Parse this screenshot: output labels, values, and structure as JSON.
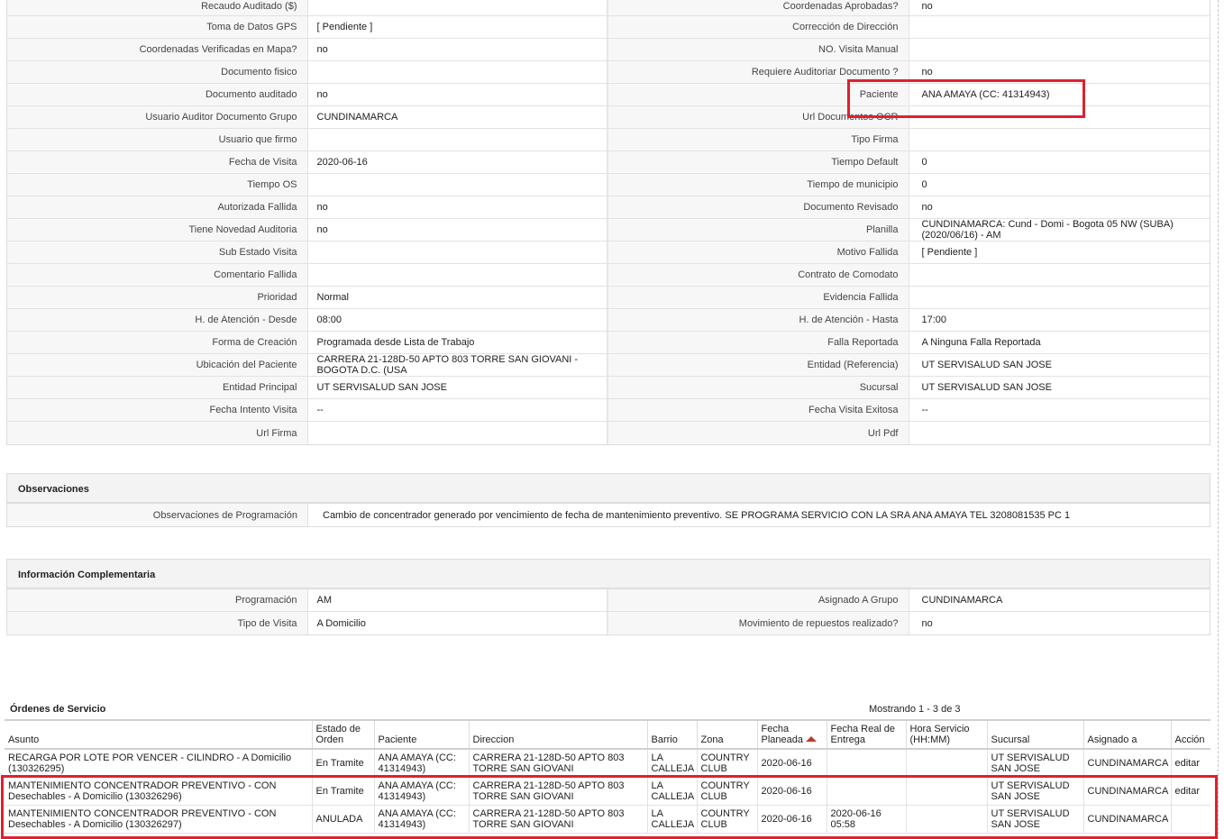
{
  "details": [
    {
      "l1": "Recaudo Auditado ($)",
      "v1": "",
      "l2": "Coordenadas Aprobadas?",
      "v2": "no"
    },
    {
      "l1": "Toma de Datos GPS",
      "v1": "[ Pendiente ]",
      "l2": "Corrección de Dirección",
      "v2": ""
    },
    {
      "l1": "Coordenadas Verificadas en Mapa?",
      "v1": "no",
      "l2": "NO. Visita Manual",
      "v2": ""
    },
    {
      "l1": "Documento fisico",
      "v1": "",
      "l2": "Requiere Auditoriar Documento ?",
      "v2": "no"
    },
    {
      "l1": "Documento auditado",
      "v1": "no",
      "l2": "Paciente",
      "v2": "ANA AMAYA (CC: 41314943)"
    },
    {
      "l1": "Usuario Auditor Documento Grupo",
      "v1": "CUNDINAMARCA",
      "l2": "Url Documentos OCR",
      "v2": ""
    },
    {
      "l1": "Usuario que firmo",
      "v1": "",
      "l2": "Tipo Firma",
      "v2": ""
    },
    {
      "l1": "Fecha de Visita",
      "v1": "2020-06-16",
      "l2": "Tiempo Default",
      "v2": "0"
    },
    {
      "l1": "Tiempo OS",
      "v1": "",
      "l2": "Tiempo de municipio",
      "v2": "0"
    },
    {
      "l1": "Autorizada Fallida",
      "v1": "no",
      "l2": "Documento Revisado",
      "v2": "no"
    },
    {
      "l1": "Tiene Novedad Auditoria",
      "v1": "no",
      "l2": "Planilla",
      "v2": "CUNDINAMARCA: Cund - Domi - Bogota 05 NW (SUBA) (2020/06/16) - AM"
    },
    {
      "l1": "Sub Estado Visita",
      "v1": "",
      "l2": "Motivo Fallida",
      "v2": "[ Pendiente ]"
    },
    {
      "l1": "Comentario Fallida",
      "v1": "",
      "l2": "Contrato de Comodato",
      "v2": ""
    },
    {
      "l1": "Prioridad",
      "v1": "Normal",
      "l2": "Evidencia Fallida",
      "v2": ""
    },
    {
      "l1": "H. de Atención - Desde",
      "v1": "08:00",
      "l2": "H. de Atención - Hasta",
      "v2": "17:00"
    },
    {
      "l1": "Forma de Creación",
      "v1": "Programada desde Lista de Trabajo",
      "l2": "Falla Reportada",
      "v2": "A Ninguna Falla Reportada"
    },
    {
      "l1": "Ubicación del Paciente",
      "v1": "CARRERA 21-128D-50 APTO 803 TORRE SAN GIOVANI - BOGOTA D.C. (USA",
      "l2": "Entidad (Referencia)",
      "v2": "UT SERVISALUD SAN JOSE"
    },
    {
      "l1": "Entidad Principal",
      "v1": "UT SERVISALUD SAN JOSE",
      "l2": "Sucursal",
      "v2": "UT SERVISALUD SAN JOSE"
    },
    {
      "l1": "Fecha Intento Visita",
      "v1": "--",
      "l2": "Fecha Visita Exitosa",
      "v2": "--"
    },
    {
      "l1": "Url Firma",
      "v1": "",
      "l2": "Url Pdf",
      "v2": ""
    }
  ],
  "observaciones": {
    "title": "Observaciones",
    "label": "Observaciones de Programación",
    "value": "Cambio de concentrador generado por vencimiento de fecha de mantenimiento preventivo. SE PROGRAMA SERVICIO CON LA SRA ANA AMAYA TEL 3208081535 PC 1"
  },
  "complementaria": {
    "title": "Información Complementaria",
    "rows": [
      {
        "l1": "Programación",
        "v1": "AM",
        "l2": "Asignado A Grupo",
        "v2": "CUNDINAMARCA"
      },
      {
        "l1": "Tipo de Visita",
        "v1": "A Domicilio",
        "l2": "Movimiento de repuestos realizado?",
        "v2": "no"
      }
    ]
  },
  "ordenes": {
    "title": "Órdenes de Servicio",
    "count": "Mostrando 1 - 3 de 3",
    "headers": {
      "asunto": "Asunto",
      "estado": "Estado de Orden",
      "paciente": "Paciente",
      "direccion": "Direccion",
      "barrio": "Barrio",
      "zona": "Zona",
      "fecha_planeada": "Fecha Planeada",
      "fecha_real": "Fecha Real de Entrega",
      "hora": "Hora Servicio (HH:MM)",
      "sucursal": "Sucursal",
      "asignado": "Asignado a",
      "accion": "Acción"
    },
    "rows": [
      {
        "asunto": "RECARGA POR LOTE POR VENCER - CILINDRO - A Domicilio (130326295)",
        "estado": "En Tramite",
        "paciente": "ANA AMAYA (CC: 41314943)",
        "direccion": "CARRERA 21-128D-50 APTO 803 TORRE SAN GIOVANI",
        "barrio": "LA CALLEJA",
        "zona": "COUNTRY CLUB",
        "fecha_planeada": "2020-06-16",
        "fecha_real": "",
        "hora": "",
        "sucursal": "UT SERVISALUD SAN JOSE",
        "asignado": "CUNDINAMARCA",
        "accion": "editar"
      },
      {
        "asunto": "MANTENIMIENTO CONCENTRADOR PREVENTIVO - CON Desechables - A Domicilio (130326296)",
        "estado": "En Tramite",
        "paciente": "ANA AMAYA (CC: 41314943)",
        "direccion": "CARRERA 21-128D-50 APTO 803 TORRE SAN GIOVANI",
        "barrio": "LA CALLEJA",
        "zona": "COUNTRY CLUB",
        "fecha_planeada": "2020-06-16",
        "fecha_real": "",
        "hora": "",
        "sucursal": "UT SERVISALUD SAN JOSE",
        "asignado": "CUNDINAMARCA",
        "accion": "editar"
      },
      {
        "asunto": "MANTENIMIENTO CONCENTRADOR PREVENTIVO - CON Desechables - A Domicilio (130326297)",
        "estado": "ANULADA",
        "paciente": "ANA AMAYA (CC: 41314943)",
        "direccion": "CARRERA 21-128D-50 APTO 803 TORRE SAN GIOVANI",
        "barrio": "LA CALLEJA",
        "zona": "COUNTRY CLUB",
        "fecha_planeada": "2020-06-16",
        "fecha_real": "2020-06-16 05:58",
        "hora": "",
        "sucursal": "UT SERVISALUD SAN JOSE",
        "asignado": "CUNDINAMARCA",
        "accion": ""
      }
    ]
  },
  "colors": {
    "highlight": "#e0202e",
    "label_bg": "#f7f7f7",
    "sort_icon": "#c0392b"
  }
}
